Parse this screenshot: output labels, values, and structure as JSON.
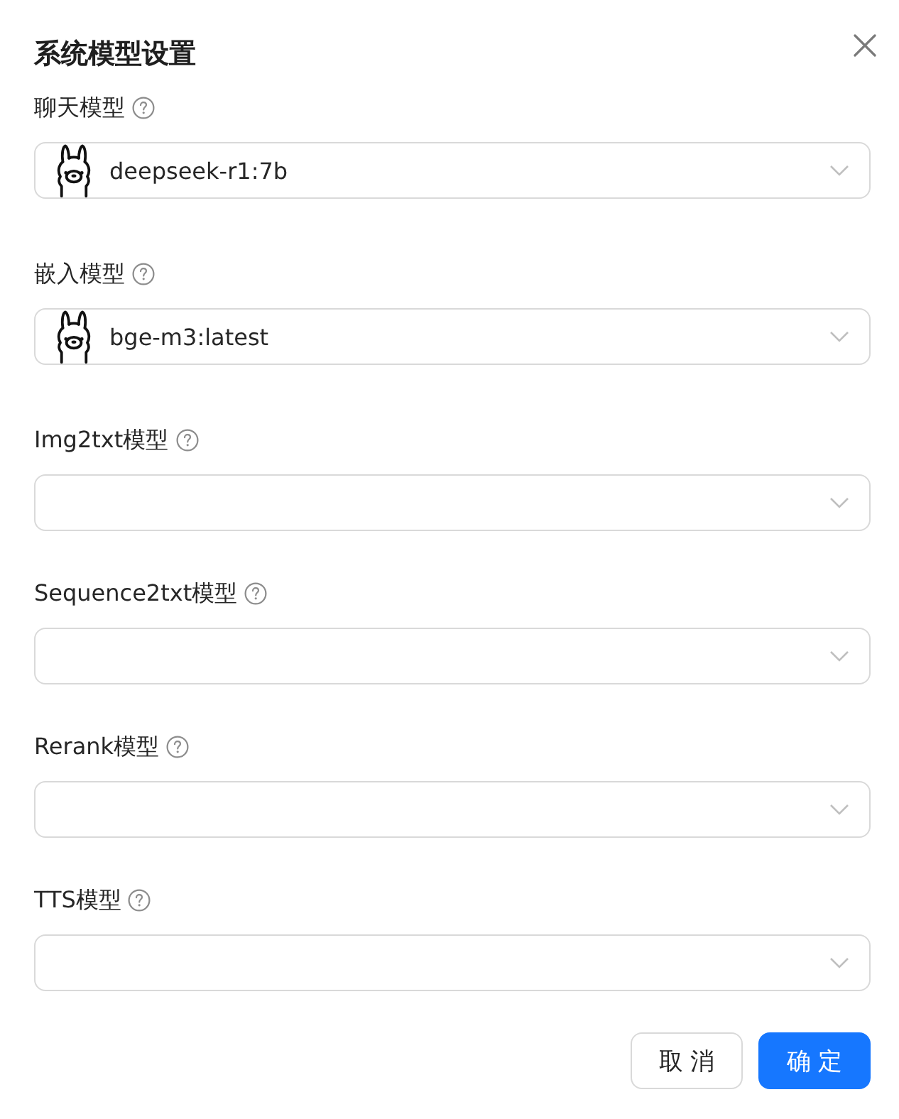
{
  "dialog": {
    "title": "系统模型设置"
  },
  "fields": [
    {
      "label": "聊天模型",
      "value": "deepseek-r1:7b"
    },
    {
      "label": "嵌入模型",
      "value": "bge-m3:latest"
    },
    {
      "label": "Img2txt模型"
    },
    {
      "label": "Sequence2txt模型"
    },
    {
      "label": "Rerank模型"
    },
    {
      "label": "TTS模型"
    }
  ],
  "buttons": [
    {
      "label": "取 消",
      "kind": "default"
    },
    {
      "label": "确 定",
      "kind": "primary"
    }
  ]
}
